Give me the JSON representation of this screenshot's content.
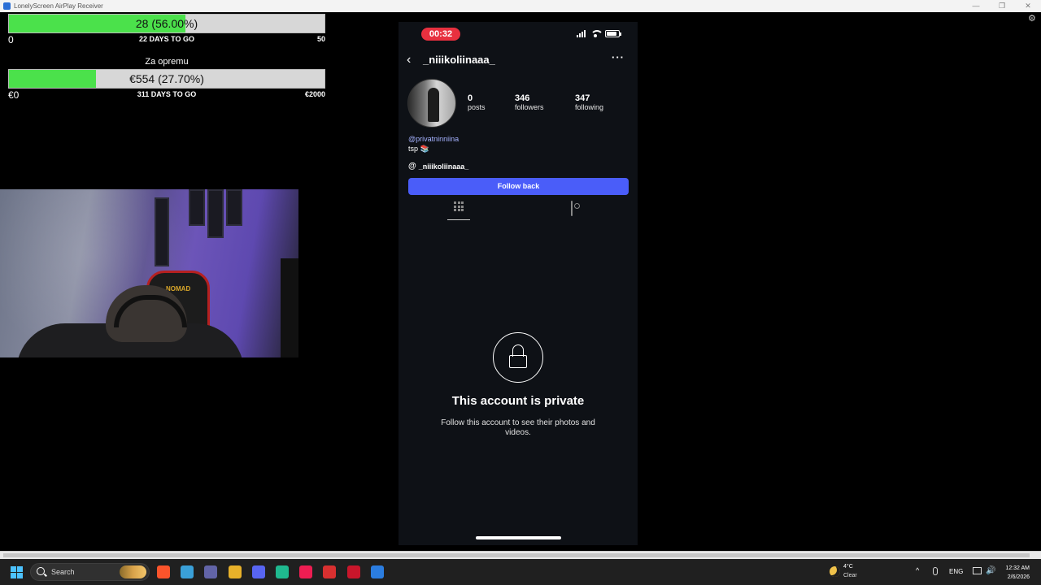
{
  "window": {
    "title": "LonelyScreen AirPlay Receiver",
    "controls": [
      "—",
      "❐",
      "✕"
    ]
  },
  "goals": [
    {
      "bar_text": "28 (56.00%)",
      "progress": 0.56,
      "min": "0",
      "days_left": "22 DAYS TO GO",
      "max": "50"
    },
    {
      "title": "Za opremu",
      "bar_text": "€554 (27.70%)",
      "progress": 0.277,
      "min": "€0",
      "days_left": "311 DAYS TO GO",
      "max": "€2000"
    }
  ],
  "phone": {
    "timer": "00:32",
    "back_glyph": "‹",
    "username": "_niiikoliinaaa_",
    "more_glyph": "···",
    "stats": {
      "posts": {
        "value": "0",
        "label": "posts"
      },
      "followers": {
        "value": "346",
        "label": "followers"
      },
      "following": {
        "value": "347",
        "label": "following"
      }
    },
    "mention": "@privatninniina",
    "bio": "tsp 📚",
    "threads_handle": "_niiikoliinaaa_",
    "threads_glyph": "@",
    "follow_button": "Follow back",
    "private_title": "This account is private",
    "private_sub": "Follow this account to see their photos and videos."
  },
  "webcam": {
    "chair_logo": "NOMAD"
  },
  "taskbar": {
    "search_placeholder": "Search",
    "apps": [
      {
        "name": "brave-icon",
        "color": "#fb542b"
      },
      {
        "name": "file-explorer-icon",
        "color": "#3aa0d8"
      },
      {
        "name": "teams-icon",
        "color": "#6264a7"
      },
      {
        "name": "chrome-icon",
        "color": "#e8b12a"
      },
      {
        "name": "discord-icon",
        "color": "#5865f2"
      },
      {
        "name": "app-green-icon",
        "color": "#1fb98f"
      },
      {
        "name": "tiktok-icon",
        "color": "#ee1d52"
      },
      {
        "name": "obs-icon",
        "color": "#d93030"
      },
      {
        "name": "tf-icon",
        "color": "#c9162b"
      },
      {
        "name": "remote-desktop-icon",
        "color": "#2b7de0"
      }
    ],
    "weather_temp": "4°C",
    "weather_cond": "Clear",
    "language": "ENG",
    "time": "12:32 AM",
    "date": "2/6/2026"
  },
  "colors": {
    "progress_fill": "#4be14b",
    "follow_button": "#4a5df9",
    "timer_pill": "#e8303f",
    "mention": "#a5b2ff"
  }
}
